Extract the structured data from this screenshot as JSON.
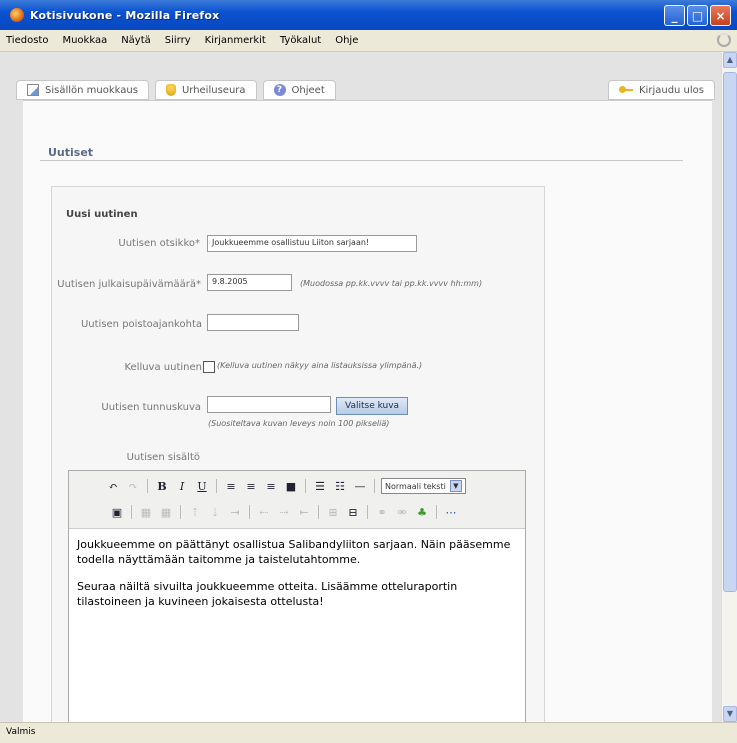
{
  "window": {
    "title": "Kotisivukone - Mozilla Firefox"
  },
  "menu": [
    "Tiedosto",
    "Muokkaa",
    "Näytä",
    "Siirry",
    "Kirjanmerkit",
    "Työkalut",
    "Ohje"
  ],
  "tabs": {
    "edit": "Sisällön muokkaus",
    "club": "Urheiluseura",
    "help": "Ohjeet",
    "logout": "Kirjaudu ulos"
  },
  "section": {
    "title": "Uutiset"
  },
  "form": {
    "title": "Uusi uutinen",
    "headline_label": "Uutisen otsikko*",
    "headline_value": "Joukkueemme osallistuu Liiton sarjaan!",
    "pubdate_label": "Uutisen julkaisupäivämäärä*",
    "pubdate_value": "9.8.2005",
    "pubdate_hint": "(Muodossa pp.kk.vvvv tai pp.kk.vvvv hh:mm)",
    "removal_label": "Uutisen poistoajankohta",
    "removal_value": "",
    "floating_label": "Kelluva uutinen",
    "floating_hint": "(Kelluva uutinen näkyy aina listauksissa ylimpänä.)",
    "image_label": "Uutisen tunnuskuva",
    "image_button": "Valitse kuva",
    "image_hint": "(Suositeltava kuvan leveys noin 100 pikseliä)",
    "content_label": "Uutisen sisältö"
  },
  "editor": {
    "format_select": "Normaali teksti",
    "paragraphs": [
      "Joukkueemme on päättänyt osallistua Salibandyliiton sarjaan. Näin pääsemme todella näyttämään taitomme ja taistelutahtomme.",
      "Seuraa näiltä sivuilta joukkueemme otteita. Lisäämme otteluraportin tilastoineen ja kuvineen jokaisesta ottelusta!"
    ]
  },
  "status": "Valmis"
}
